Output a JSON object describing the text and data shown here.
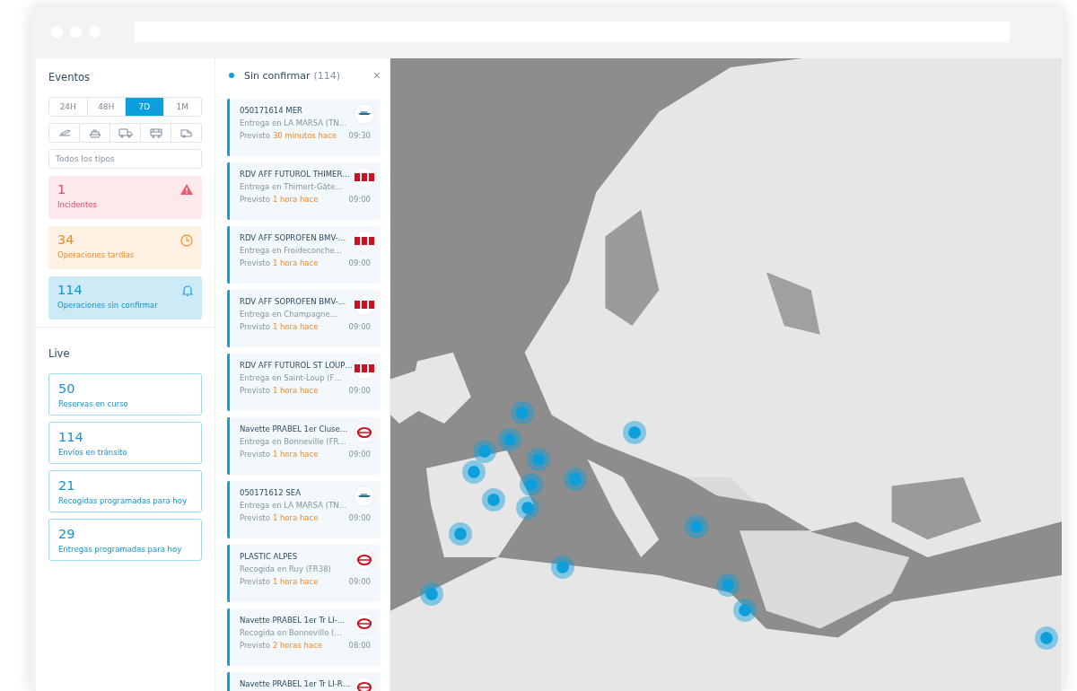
{
  "events": {
    "title": "Eventos",
    "periods": [
      {
        "label": "24H",
        "selected": false
      },
      {
        "label": "48H",
        "selected": false
      },
      {
        "label": "7D",
        "selected": true
      },
      {
        "label": "1M",
        "selected": false
      }
    ],
    "transport_filters": [
      {
        "kind": "plane",
        "selected": false
      },
      {
        "kind": "ship",
        "selected": false
      },
      {
        "kind": "truck",
        "selected": false
      },
      {
        "kind": "train",
        "selected": false
      },
      {
        "kind": "van",
        "selected": false
      }
    ],
    "type_select": {
      "value": "Todos los tipos"
    },
    "stats": [
      {
        "kind": "incident",
        "count": "1",
        "label": "Incidentes"
      },
      {
        "kind": "late",
        "count": "34",
        "label": "Operaciones tardías"
      },
      {
        "kind": "unconfirmed",
        "count": "114",
        "label": "Operaciones sin confirmar"
      }
    ]
  },
  "live": {
    "title": "Live",
    "stats": [
      {
        "count": "50",
        "label": "Reservas en curso"
      },
      {
        "count": "114",
        "label": "Envíos en tránsito"
      },
      {
        "count": "21",
        "label": "Recogidas programadas para hoy"
      },
      {
        "count": "29",
        "label": "Entregas programadas para hoy"
      }
    ]
  },
  "list": {
    "title": "Sin confirmar",
    "count": "(114)",
    "close": "×",
    "items": [
      {
        "title": "050171614 MER",
        "place": "Entrega en LA MARSA (TN…",
        "prefix": "Previsto",
        "ago": "30 minutos hace",
        "time": "09:30",
        "kind": "ship"
      },
      {
        "title": "RDV AFF FUTUROL THIMER…",
        "place": "Entrega en Thimert-Gâte…",
        "prefix": "Previsto",
        "ago": "1 hora hace",
        "time": "09:00",
        "kind": "bmv"
      },
      {
        "title": "RDV AFF SOPROFEN BMV-…",
        "place": "Entrega en Froideconche…",
        "prefix": "Previsto",
        "ago": "1 hora hace",
        "time": "09:00",
        "kind": "bmv"
      },
      {
        "title": "RDV AFF SOPROFEN BMV-…",
        "place": "Entrega en Champagne…",
        "prefix": "Previsto",
        "ago": "1 hora hace",
        "time": "09:00",
        "kind": "bmv"
      },
      {
        "title": "RDV AFF FUTUROL ST LOUP…",
        "place": "Entrega en Saint-Loup (F…",
        "prefix": "Previsto",
        "ago": "1 hora hace",
        "time": "09:00",
        "kind": "bmv"
      },
      {
        "title": "Navette PRABEL 1er Cluse…",
        "place": "Entrega en Bonneville (FR…",
        "prefix": "Previsto",
        "ago": "1 hora hace",
        "time": "09:00",
        "kind": "swirl"
      },
      {
        "title": "050171612 SEA",
        "place": "Entrega en LA MARSA (TN…",
        "prefix": "Previsto",
        "ago": "1 hora hace",
        "time": "09:00",
        "kind": "ship"
      },
      {
        "title": "PLASTIC ALPES",
        "place": "Recogida en Ruy (FR38)",
        "prefix": "Previsto",
        "ago": "1 hora hace",
        "time": "09:00",
        "kind": "swirl"
      },
      {
        "title": "Navette PRABEL 1er Tr LI-…",
        "place": "Recogida en Bonneville (…",
        "prefix": "Previsto",
        "ago": "2 horas hace",
        "time": "08:00",
        "kind": "swirl"
      },
      {
        "title": "Navette PRABEL 1er Tr LI-R…",
        "kind": "swirl"
      }
    ]
  }
}
